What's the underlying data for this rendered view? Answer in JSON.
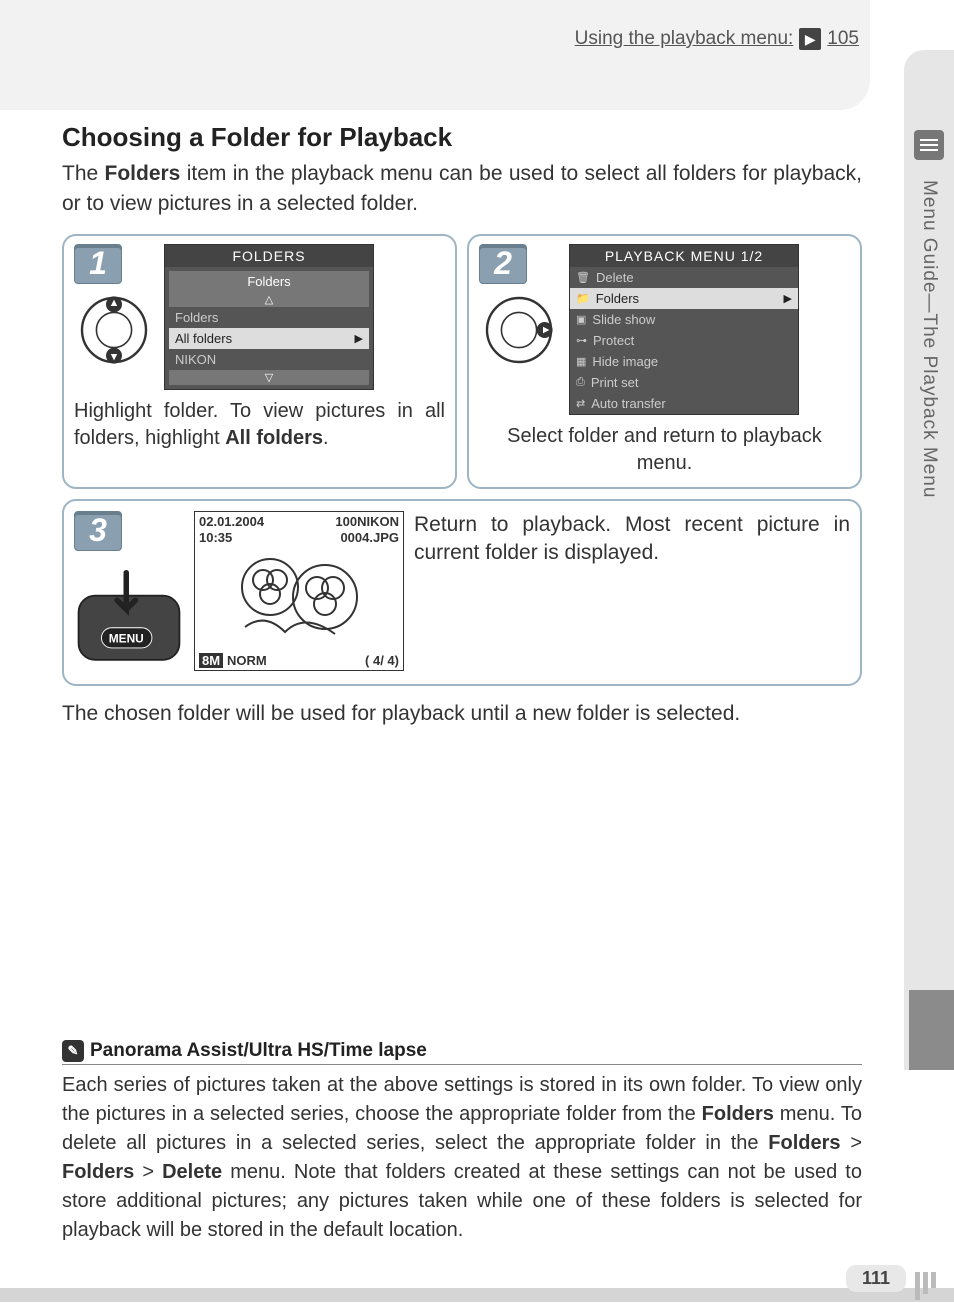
{
  "header": {
    "ref_text": "Using the playback menu:",
    "ref_page": "105"
  },
  "side_tab": "Menu Guide—The Playback Menu",
  "title": "Choosing a Folder for Playback",
  "intro_pre": "The ",
  "intro_bold": "Folders",
  "intro_post": " item in the playback menu can be used to select all folders for playback, or to view pictures in a selected folder.",
  "step1": {
    "num": "1",
    "screen_title": "FOLDERS",
    "screen_sub": "Folders",
    "rows": [
      "Folders",
      "All folders",
      "NIKON"
    ],
    "sel_index": 1,
    "caption_pre": "Highlight folder.  To view pictures in all folders, highlight ",
    "caption_bold": "All folders",
    "caption_post": "."
  },
  "step2": {
    "num": "2",
    "screen_title": "PLAYBACK MENU  1/2",
    "rows": [
      "Delete",
      "Folders",
      "Slide show",
      "Protect",
      "Hide image",
      "Print set",
      "Auto transfer"
    ],
    "sel_index": 1,
    "caption": "Select folder and return to playback menu."
  },
  "step3": {
    "num": "3",
    "date": "02.01.2004",
    "time": "10:35",
    "folder": "100NIKON",
    "file": "0004.JPG",
    "size_badge": "8M",
    "quality": "NORM",
    "count": "(    4/    4)",
    "menu_label": "MENU",
    "caption": "Return to playback.  Most recent picture in current folder is displayed."
  },
  "body2": "The chosen folder will be used for playback until a new folder is selected.",
  "note": {
    "title": "Panorama Assist/Ultra HS/Time lapse",
    "b1": "Folders",
    "b2": "Folders",
    "b3": "Folders",
    "b4": "Delete",
    "text_pre": "Each series of pictures taken at the above settings is stored in its own folder.  To view only the pictures in a selected series, choose the appropriate folder from the ",
    "text_mid1": " menu.  To delete all pictures in a selected series, select the appropriate folder in the ",
    "text_mid2": " > ",
    "text_mid3": " > ",
    "text_post": " menu.  Note that folders created at these settings can not be used to store additional pictures; any pictures taken while one of these folders is selected for playback will be stored in the default location."
  },
  "page_number": "111"
}
